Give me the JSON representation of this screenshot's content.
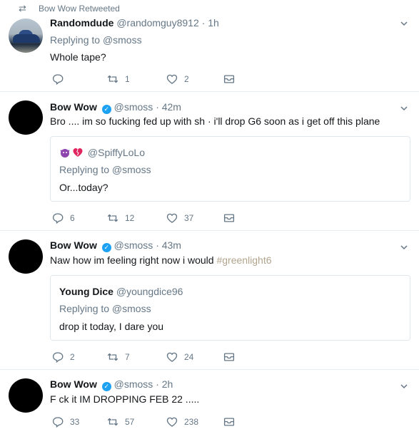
{
  "tweets": [
    {
      "retweet_context": "Bow Wow Retweeted",
      "name": "Randomdude",
      "handle": "@randomguy8912",
      "time": "· 1h",
      "replying_prefix": "Replying to",
      "replying_to": "@smoss",
      "text": "Whole tape?",
      "replies": "",
      "retweets": "1",
      "likes": "2"
    },
    {
      "name": "Bow Wow",
      "handle": "@smoss",
      "time": "· 42m",
      "text": "Bro .... im so fucking fed up with sh  · i'll drop G6 soon as i get off this plane",
      "quote": {
        "emoji": [
          "purple-devil-emoji",
          "broken-heart-emoji"
        ],
        "handle": "@SpiffyLoLo",
        "replying": "Replying to @smoss",
        "text": "Or...today?"
      },
      "replies": "6",
      "retweets": "12",
      "likes": "37"
    },
    {
      "name": "Bow Wow",
      "handle": "@smoss",
      "time": "· 43m",
      "text": "Naw how im feeling right now i would ",
      "hashtag": "#greenlight6",
      "quote": {
        "name": "Young Dice",
        "handle": "@youngdice96",
        "replying": "Replying to @smoss",
        "text": "drop it today, I dare you"
      },
      "replies": "2",
      "retweets": "7",
      "likes": "24"
    },
    {
      "name": "Bow Wow",
      "handle": "@smoss",
      "time": "· 2h",
      "text": "F  ck it IM DROPPING FEB 22 .....",
      "replies": "33",
      "retweets": "57",
      "likes": "238"
    }
  ],
  "colors": {
    "accent": "#1da1f2",
    "muted": "#657786",
    "hashtag": "#b1a48d",
    "border": "#e6ecf0"
  }
}
